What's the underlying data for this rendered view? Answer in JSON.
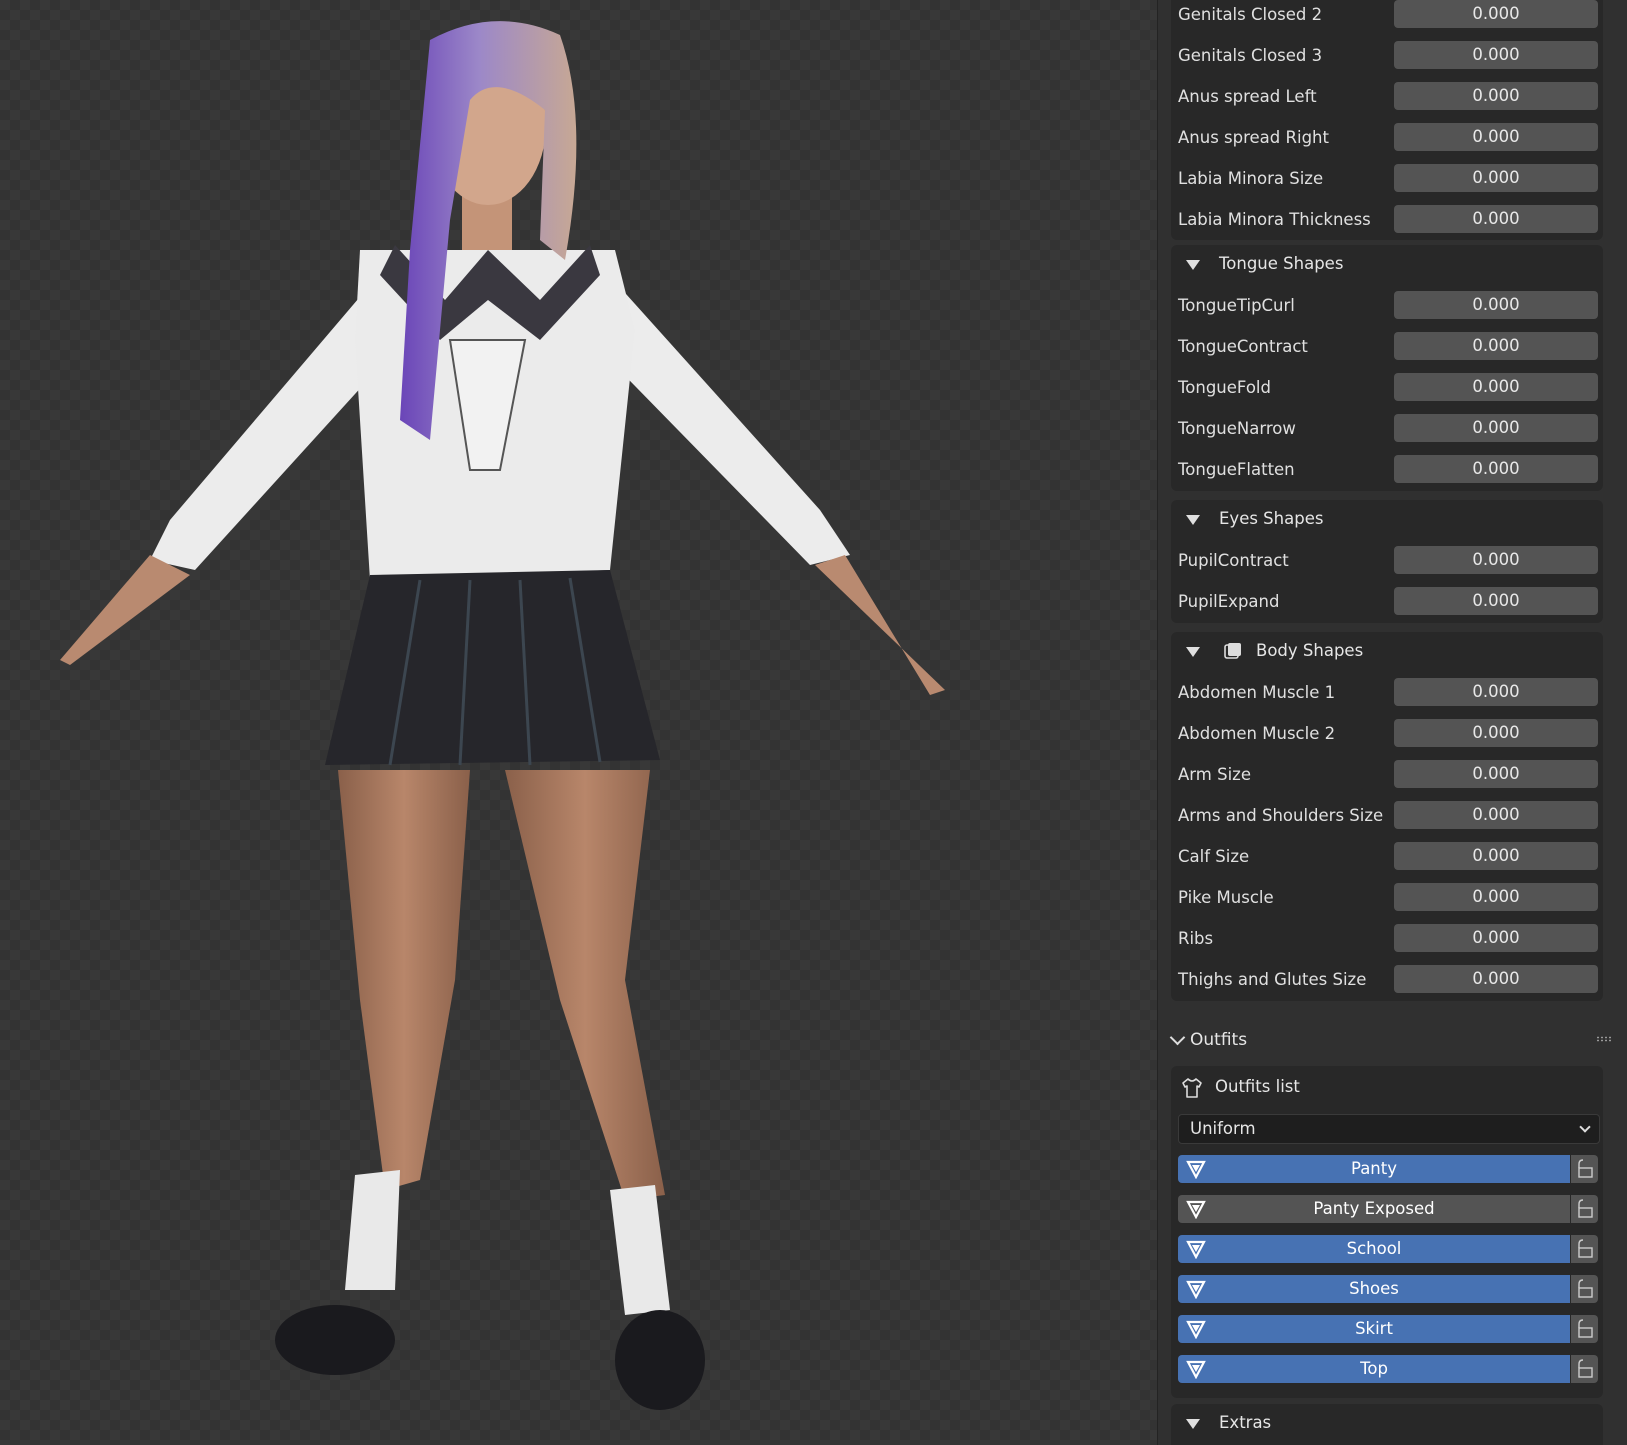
{
  "shape_rows_top": [
    {
      "label": "Genitals Closed 2",
      "value": "0.000"
    },
    {
      "label": "Genitals Closed 3",
      "value": "0.000"
    },
    {
      "label": "Anus spread Left",
      "value": "0.000"
    },
    {
      "label": "Anus spread Right",
      "value": "0.000"
    },
    {
      "label": "Labia Minora Size",
      "value": "0.000"
    },
    {
      "label": "Labia Minora Thickness",
      "value": "0.000"
    }
  ],
  "tongue": {
    "title": "Tongue Shapes",
    "rows": [
      {
        "label": "TongueTipCurl",
        "value": "0.000"
      },
      {
        "label": "TongueContract",
        "value": "0.000"
      },
      {
        "label": "TongueFold",
        "value": "0.000"
      },
      {
        "label": "TongueNarrow",
        "value": "0.000"
      },
      {
        "label": "TongueFlatten",
        "value": "0.000"
      }
    ]
  },
  "eyes": {
    "title": "Eyes Shapes",
    "rows": [
      {
        "label": "PupilContract",
        "value": "0.000"
      },
      {
        "label": "PupilExpand",
        "value": "0.000"
      }
    ]
  },
  "body": {
    "title": "Body Shapes",
    "rows": [
      {
        "label": "Abdomen Muscle 1",
        "value": "0.000"
      },
      {
        "label": "Abdomen Muscle 2",
        "value": "0.000"
      },
      {
        "label": "Arm Size",
        "value": "0.000"
      },
      {
        "label": "Arms and Shoulders Size",
        "value": "0.000"
      },
      {
        "label": "Calf Size",
        "value": "0.000"
      },
      {
        "label": "Pike Muscle",
        "value": "0.000"
      },
      {
        "label": "Ribs",
        "value": "0.000"
      },
      {
        "label": "Thighs and Glutes Size",
        "value": "0.000"
      }
    ]
  },
  "outfits": {
    "section_title": "Outfits",
    "list_title": "Outfits list",
    "selected": "Uniform",
    "items": [
      {
        "label": "Panty",
        "active": true
      },
      {
        "label": "Panty Exposed",
        "active": false
      },
      {
        "label": "School",
        "active": true
      },
      {
        "label": "Shoes",
        "active": true
      },
      {
        "label": "Skirt",
        "active": true
      },
      {
        "label": "Top",
        "active": true
      }
    ]
  },
  "extras": {
    "title": "Extras"
  },
  "colors": {
    "accent": "#4772b3",
    "field": "#545454",
    "panel": "#303030",
    "group": "#282828"
  }
}
